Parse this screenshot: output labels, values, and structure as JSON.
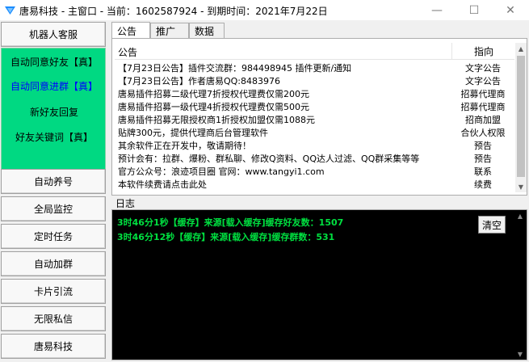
{
  "window": {
    "title": "唐易科技 - 主窗口 - 当前：1602587924 - 到期时间：2021年7月22日",
    "minimize_icon": "minimize-icon",
    "maximize_icon": "maximize-icon",
    "close_icon": "close-icon"
  },
  "sidebar": {
    "top_button": "机器人客服",
    "green_items": [
      {
        "label": "自动同意好友【真】",
        "color": "#000000"
      },
      {
        "label": "自动同意进群【真】",
        "color": "#0000ff"
      },
      {
        "label": "新好友回复",
        "color": "#000000"
      },
      {
        "label": "好友关键词【真】",
        "color": "#000000"
      }
    ],
    "buttons": [
      "自动养号",
      "全局监控",
      "定时任务",
      "自动加群",
      "卡片引流",
      "无限私信",
      "唐易科技"
    ]
  },
  "tabs": [
    {
      "label": "公告",
      "active": true
    },
    {
      "label": "推广",
      "active": false
    },
    {
      "label": "数据",
      "active": false
    }
  ],
  "announcements": {
    "headers": [
      "公告",
      "指向"
    ],
    "rows": [
      {
        "text": "【7月23日公告】插件交流群：984498945 插件更新/通知",
        "target": "文字公告"
      },
      {
        "text": "【7月23日公告】作者唐易QQ:8483976",
        "target": "文字公告"
      },
      {
        "text": "唐易插件招募二级代理7折授权代理费仅需200元",
        "target": "招募代理商"
      },
      {
        "text": "唐易插件招募一级代理4折授权代理费仅需500元",
        "target": "招募代理商"
      },
      {
        "text": "唐易插件招募无限授权商1折授权加盟仅需1088元",
        "target": "招商加盟"
      },
      {
        "text": "贴牌300元，提供代理商后台管理软件",
        "target": "合伙人权限"
      },
      {
        "text": "其余软件正在开发中，敬请期待！",
        "target": "预告"
      },
      {
        "text": "预计会有：拉群、爆粉、群私聊、修改Q资料、QQ达人过滤、QQ群采集等等",
        "target": "预告"
      },
      {
        "text": "官方公众号：浪迹项目圈 官网：www.tangyi1.com",
        "target": "联系"
      },
      {
        "text": "本软件续费请点击此处",
        "target": "续费"
      }
    ]
  },
  "log": {
    "label": "日志",
    "clear_button": "清空",
    "lines": [
      "3时46分1秒【缓存】来源[载入缓存]缓存好友数：1507",
      "3时46分12秒【缓存】来源[载入缓存]缓存群数：531"
    ],
    "text_color": "#00e040"
  },
  "colors": {
    "green_panel": "#00d982",
    "app_icon": "#1a8cff"
  }
}
